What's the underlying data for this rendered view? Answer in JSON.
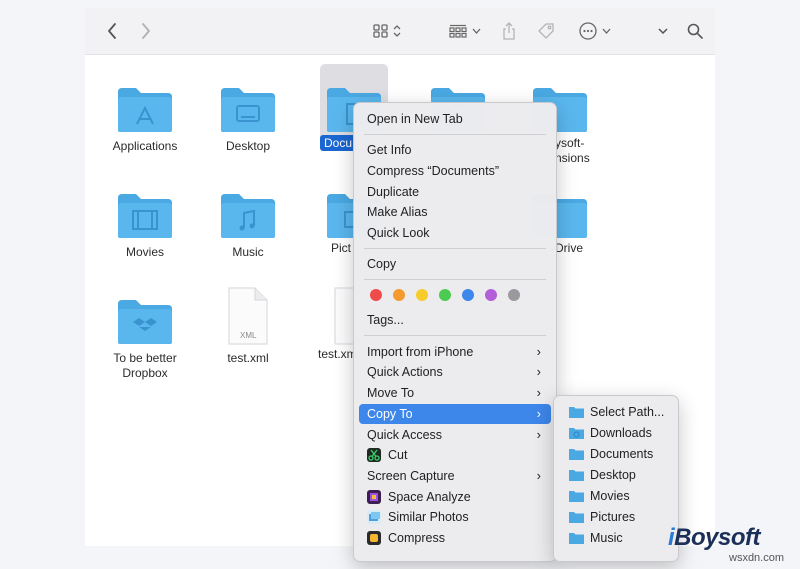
{
  "toolbar": {
    "icons": [
      "chevron-left-icon",
      "chevron-right-icon",
      "icon-view-icon",
      "group-icon",
      "share-icon",
      "tag-icon",
      "more-icon",
      "chevron-down-icon",
      "search-icon"
    ]
  },
  "files": [
    {
      "label": "Applications"
    },
    {
      "label": "Desktop"
    },
    {
      "label": "Documents"
    },
    {
      "label": ""
    },
    {
      "label": "iBoysoft-Extensions"
    },
    {
      "label": "Movies"
    },
    {
      "label": "Music"
    },
    {
      "label": "Pictures"
    },
    {
      "label": ""
    },
    {
      "label": "OneDrive"
    },
    {
      "label": "To be better Dropbox"
    },
    {
      "label": "test.xml",
      "ext": "XML"
    },
    {
      "label": "test.xml"
    }
  ],
  "visible_labels": {
    "applications": "Applications",
    "desktop": "Desktop",
    "documents_sel": "Docu",
    "ext_partial": "ysoft-",
    "ext_partial2": "nsions",
    "movies": "Movies",
    "music": "Music",
    "pictures_partial": "Pict",
    "onedrive_partial": "-Drive",
    "dropbox": "To be better Dropbox",
    "testxml1": "test.xml",
    "testxml2": "test.xm",
    "xml_ext": "XML"
  },
  "context_menu": {
    "items": {
      "open_new_tab": "Open in New Tab",
      "get_info": "Get Info",
      "compress": "Compress “Documents”",
      "duplicate": "Duplicate",
      "make_alias": "Make Alias",
      "quick_look": "Quick Look",
      "copy": "Copy",
      "tags": "Tags...",
      "import_iphone": "Import from iPhone",
      "quick_actions": "Quick Actions",
      "move_to": "Move To",
      "copy_to": "Copy To",
      "quick_access": "Quick Access",
      "cut": "Cut",
      "screen_capture": "Screen Capture",
      "space_analyze": "Space Analyze",
      "similar_photos": "Similar Photos",
      "compress_app": "Compress"
    },
    "tag_colors": [
      "#ef4b4b",
      "#f59a2f",
      "#f5cc2b",
      "#4ccb52",
      "#3d86ea",
      "#b15ed8",
      "#9a9a9e"
    ],
    "chevron": "›"
  },
  "submenu": {
    "items": {
      "select_path": "Select Path...",
      "downloads": "Downloads",
      "documents": "Documents",
      "desktop": "Desktop",
      "movies": "Movies",
      "pictures": "Pictures",
      "music": "Music"
    }
  },
  "watermark": {
    "brand_i": "i",
    "brand_rest": "Boysoft",
    "site": "wsxdn.com"
  },
  "colors": {
    "folder": "#5ab7ee",
    "folder_tab": "#4aa8e2",
    "highlight": "#3d86ea",
    "selection": "#1a66d2"
  }
}
